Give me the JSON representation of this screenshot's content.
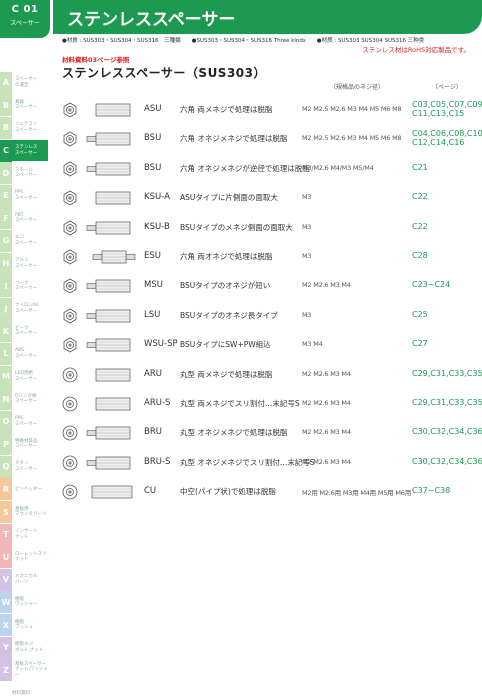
{
  "header": {
    "section_code": "C 01",
    "section_sub": "スペーサー",
    "title": "ステンレススペーサー",
    "materials": "●材質 : SUS303・SUS304・SUS316　三種類　　●SUS303・SUS304・SUS316 Three kinds　　●材质 : SUS303 SUS304 SUS316 三种类",
    "rohs": "ステンレス材はRoHS対応製品です。",
    "ref": "材料資料03ページ参照",
    "page_title": "ステンレススペーサー（SUS303）",
    "col_sizes": "（規格品のネジ径）",
    "col_pages": "（ページ）"
  },
  "side_index": [
    {
      "letter": "A",
      "label": "スペーサー\nの選定",
      "style": "green"
    },
    {
      "letter": "B",
      "label": "真鍮\nスペーサー",
      "style": "green"
    },
    {
      "letter": "B",
      "label": "ジュラコン\nスペーサー",
      "style": "green"
    },
    {
      "letter": "C",
      "label": "ステンレス\nスペーサー",
      "style": "active"
    },
    {
      "letter": "D",
      "label": "スチール\nスペーサー",
      "style": "green"
    },
    {
      "letter": "E",
      "label": "PPS\nスペーサー",
      "style": "green"
    },
    {
      "letter": "F",
      "label": "PBT\nスペーサー",
      "style": "green"
    },
    {
      "letter": "G",
      "label": "エコ\nスペーサー",
      "style": "green"
    },
    {
      "letter": "H",
      "label": "アルミ\nスペーサー",
      "style": "green"
    },
    {
      "letter": "I",
      "label": "ベーク\nスペーサー",
      "style": "green"
    },
    {
      "letter": "J",
      "label": "ナイロン66\nスペーサー",
      "style": "green"
    },
    {
      "letter": "K",
      "label": "ピーク\nスペーサー",
      "style": "green"
    },
    {
      "letter": "L",
      "label": "ABS\nスペーサー",
      "style": "green"
    },
    {
      "letter": "M",
      "label": "LED用絶\nスペーサー",
      "style": "green"
    },
    {
      "letter": "N",
      "label": "Oリング絶\nスペーサー",
      "style": "green"
    },
    {
      "letter": "O",
      "label": "PPS\nスペーサー",
      "style": "green"
    },
    {
      "letter": "P",
      "label": "特殊材質品\nスペーサー",
      "style": "green"
    },
    {
      "letter": "Q",
      "label": "チタン\nスペーサー",
      "style": "green"
    },
    {
      "letter": "R",
      "label": "ピンヘッダー",
      "style": "orange"
    },
    {
      "letter": "S",
      "label": "基板用\nマウンタパーツ",
      "style": "orange"
    },
    {
      "letter": "T",
      "label": "インサート\nナット",
      "style": "pink"
    },
    {
      "letter": "U",
      "label": "ローレットスリ\nナット",
      "style": "pink"
    },
    {
      "letter": "V",
      "label": "メカニカル\nパーツ",
      "style": "purple"
    },
    {
      "letter": "W",
      "label": "樹脂\nワッシャー",
      "style": "blue"
    },
    {
      "letter": "X",
      "label": "樹脂\nブッシュ",
      "style": "blue"
    },
    {
      "letter": "Y",
      "label": "樹脂ネジ\nボルト,ナット",
      "style": "purple"
    },
    {
      "letter": "Z",
      "label": "基板スペーサー\nナット,ワッシャー",
      "style": "purple"
    }
  ],
  "side_footer": "材料資料",
  "rows": [
    {
      "code": "ASU",
      "desc": "六角 両メネジで処理は脱脂",
      "sizes": "M2 M2.5 M2.6 M3 M4 M5 M6 M8",
      "pages": "C03,C05,C07,C09\nC11,C13,C15",
      "shape": "hex",
      "type": "ff"
    },
    {
      "code": "BSU",
      "desc": "六角 オネジメネジで処理は脱脂",
      "sizes": "M2 M2.5 M2.6 M3 M4 M5 M6 M8",
      "pages": "C04,C06,C08,C10\nC12,C14,C16",
      "shape": "hex",
      "type": "mf"
    },
    {
      "code": "BSU",
      "desc": "六角 オネジメネジが逆径で処理は脱脂",
      "sizes": "M3/M2.6 M4/M3 M5/M4",
      "pages": "C21",
      "shape": "hex",
      "type": "mf"
    },
    {
      "code": "KSU-A",
      "desc": "ASUタイプに片側面の面取大",
      "sizes": "M3",
      "pages": "C22",
      "shape": "hex",
      "type": "ff"
    },
    {
      "code": "KSU-B",
      "desc": "BSUタイプのメネジ側面の面取大",
      "sizes": "M3",
      "pages": "C22",
      "shape": "hex",
      "type": "mf"
    },
    {
      "code": "ESU",
      "desc": "六角 両オネジで処理は脱脂",
      "sizes": "M3",
      "pages": "C28",
      "shape": "hex",
      "type": "mm"
    },
    {
      "code": "MSU",
      "desc": "BSUタイプのオネジが短い",
      "sizes": "M2 M2.6 M3 M4",
      "pages": "C23~C24",
      "shape": "hex",
      "type": "mf"
    },
    {
      "code": "LSU",
      "desc": "BSUタイプのオネジ長タイプ",
      "sizes": "M3",
      "pages": "C25",
      "shape": "hex",
      "type": "mf"
    },
    {
      "code": "WSU-SP",
      "desc": "BSUタイプにSW+PW組込",
      "sizes": "M3 M4",
      "pages": "C27",
      "shape": "hex",
      "type": "mf"
    },
    {
      "code": "ARU",
      "desc": "丸型 両メネジで処理は脱脂",
      "sizes": "M2 M2.6 M3 M4",
      "pages": "C29,C31,C33,C35",
      "shape": "round",
      "type": "ff"
    },
    {
      "code": "ARU-S",
      "desc": "丸型 両メネジでスリ割付…末記号S",
      "sizes": "M2 M2.6 M3 M4",
      "pages": "C29,C31,C33,C35",
      "shape": "round",
      "type": "ff"
    },
    {
      "code": "BRU",
      "desc": "丸型 オネジメネジで処理は脱脂",
      "sizes": "M2 M2.6 M3 M4",
      "pages": "C30,C32,C34,C36",
      "shape": "round",
      "type": "mf"
    },
    {
      "code": "BRU-S",
      "desc": "丸型 オネジメネジでスリ割付…末記号S",
      "sizes": "M2 M2.6 M3 M4",
      "pages": "C30,C32,C34,C36",
      "shape": "round",
      "type": "mf"
    },
    {
      "code": "CU",
      "desc": "中空(パイプ状)で処理は脱脂",
      "sizes": "M2用 M2.6用 M3用 M4用 M5用 M6用",
      "pages": "C37~C38",
      "shape": "round",
      "type": "pipe"
    }
  ]
}
